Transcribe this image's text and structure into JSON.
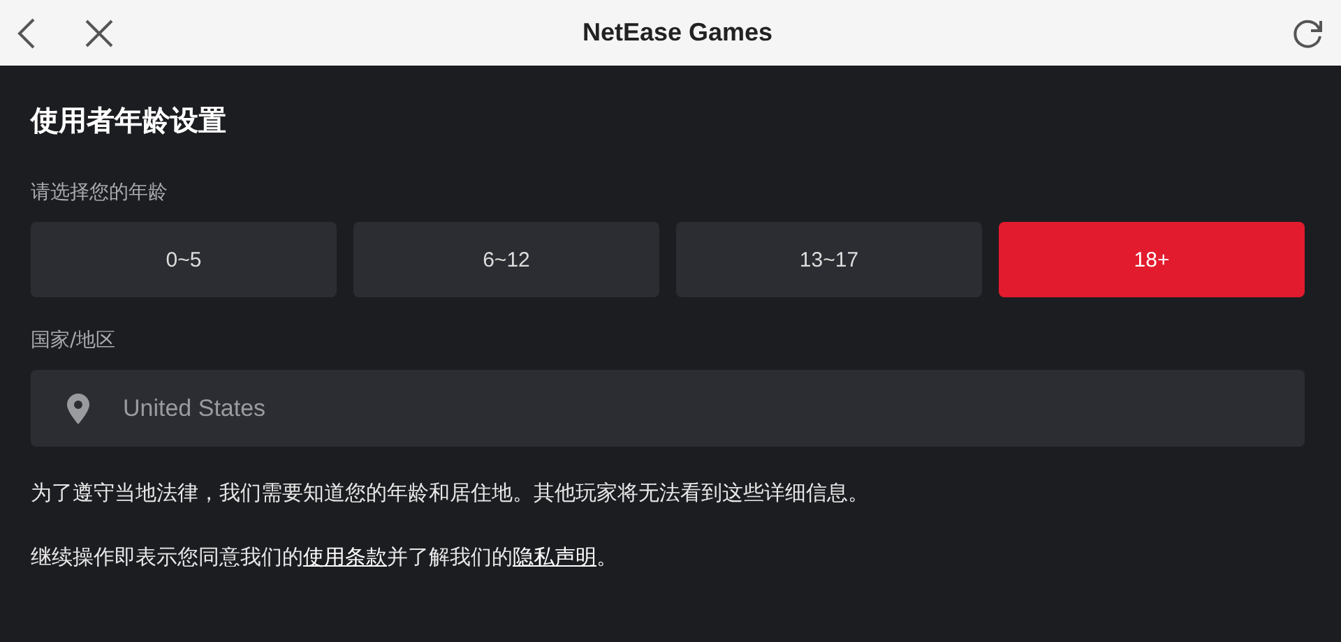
{
  "header": {
    "title": "NetEase Games"
  },
  "page_title": "使用者年龄设置",
  "age_label": "请选择您的年龄",
  "age_options": [
    {
      "label": "0~5",
      "selected": false
    },
    {
      "label": "6~12",
      "selected": false
    },
    {
      "label": "13~17",
      "selected": false
    },
    {
      "label": "18+",
      "selected": true
    }
  ],
  "region_label": "国家/地区",
  "region_field": {
    "value": "United States"
  },
  "notice": "为了遵守当地法律，我们需要知道您的年龄和居住地。其他玩家将无法看到这些详细信息。",
  "consent": [
    {
      "kind": "text",
      "text": "继续操作即表示您同意我们的"
    },
    {
      "kind": "link",
      "text": "使用条款"
    },
    {
      "kind": "text",
      "text": "并了解我们的"
    },
    {
      "kind": "link",
      "text": "隐私声明"
    },
    {
      "kind": "text",
      "text": "。"
    }
  ]
}
